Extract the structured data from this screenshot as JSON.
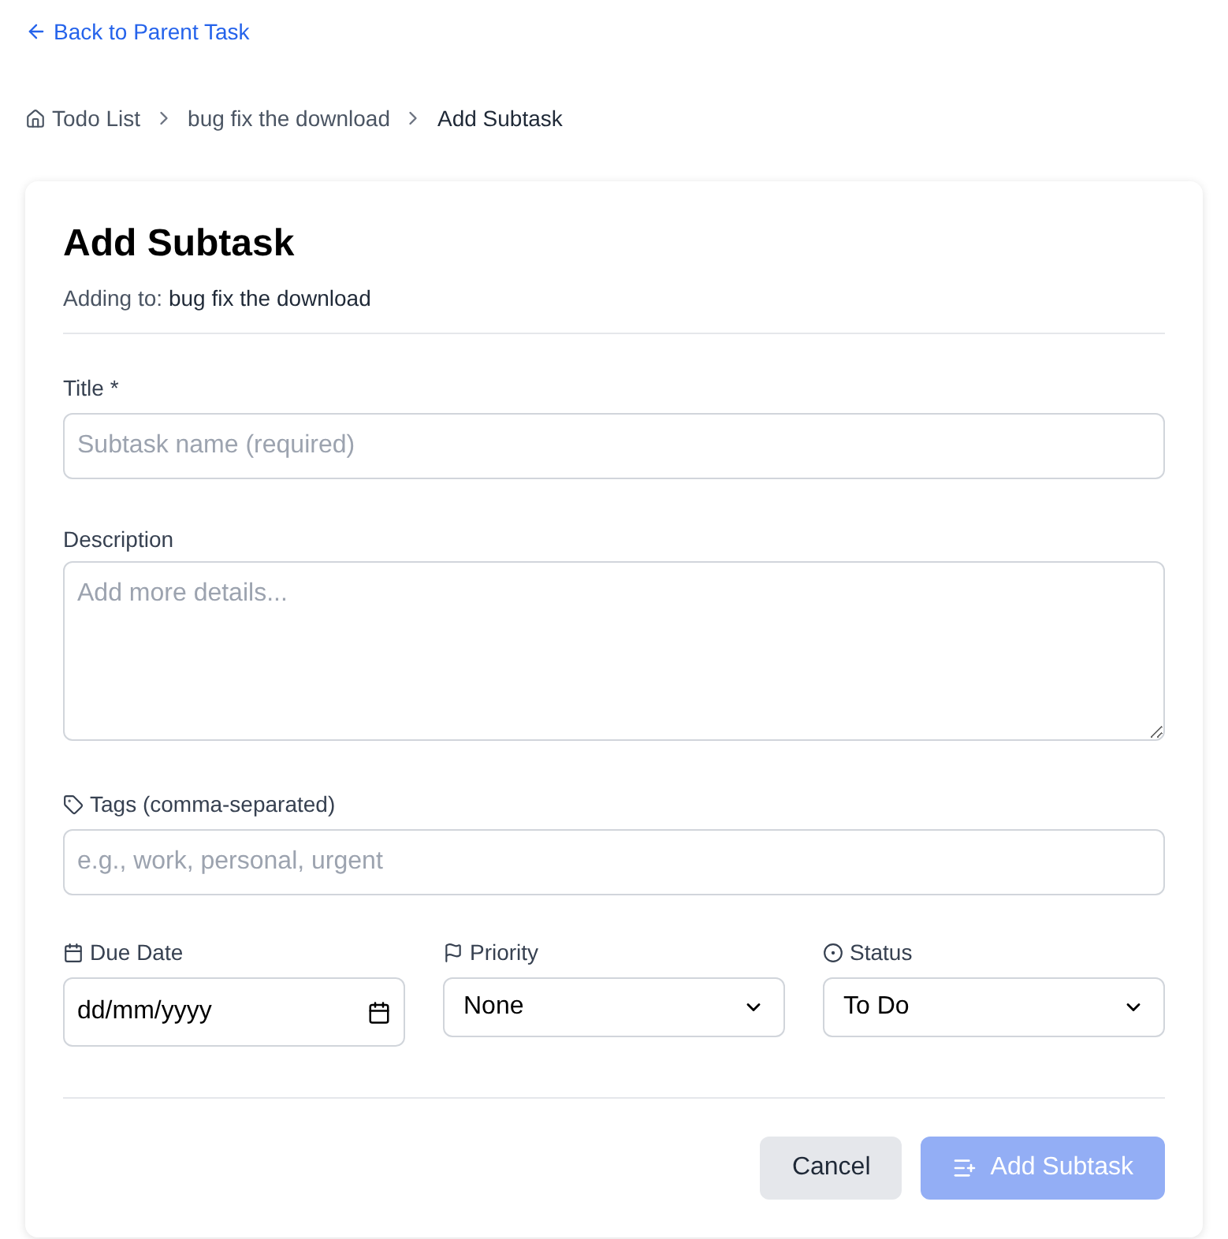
{
  "back_link": "Back to Parent Task",
  "breadcrumb": [
    {
      "label": "Todo List",
      "kind": "home"
    },
    {
      "label": "bug fix the download",
      "kind": "link"
    },
    {
      "label": "Add Subtask",
      "kind": "current"
    }
  ],
  "form": {
    "title": "Add Subtask",
    "subtitle_prefix": "Adding to:",
    "subtitle_parent": "bug fix the download",
    "title_field": {
      "label": "Title *",
      "placeholder": "Subtask name (required)"
    },
    "description_field": {
      "label": "Description",
      "placeholder": "Add more details..."
    },
    "tags_field": {
      "label": "Tags (comma-separated)",
      "placeholder": "e.g., work, personal, urgent"
    },
    "due_date": {
      "label": "Due Date",
      "value": "dd/mm/yyyy"
    },
    "priority": {
      "label": "Priority",
      "value": "None"
    },
    "status": {
      "label": "Status",
      "value": "To Do"
    },
    "cancel_button": "Cancel",
    "submit_button": {
      "label": "Add Subtask",
      "disabled": true
    }
  }
}
